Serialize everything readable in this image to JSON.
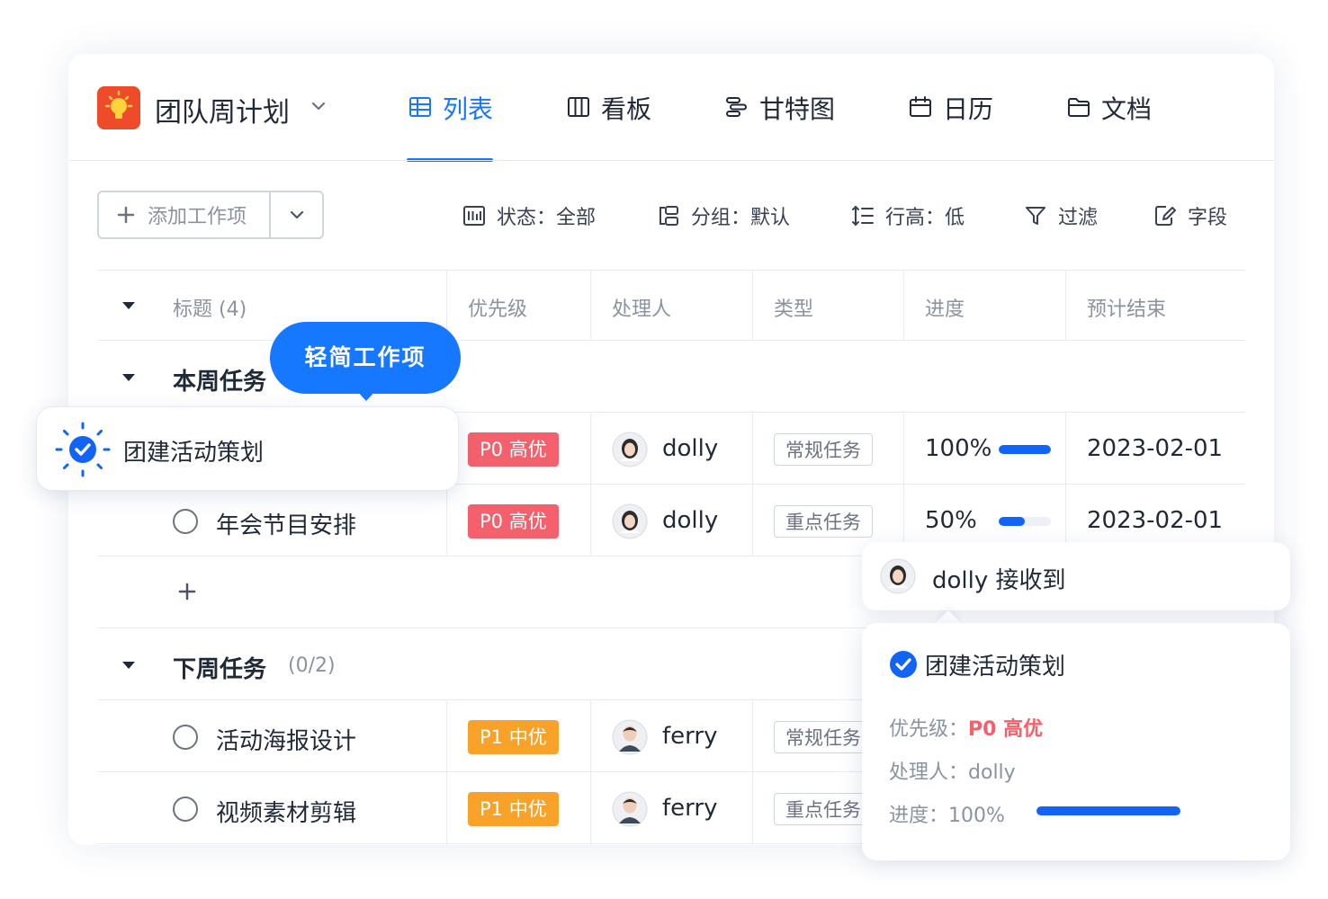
{
  "project": {
    "title": "团队周计划",
    "logo_icon": "lightbulb-icon"
  },
  "tabs": [
    {
      "label": "列表",
      "icon": "table-icon",
      "active": true
    },
    {
      "label": "看板",
      "icon": "kanban-icon",
      "active": false
    },
    {
      "label": "甘特图",
      "icon": "gantt-icon",
      "active": false
    },
    {
      "label": "日历",
      "icon": "calendar-icon",
      "active": false
    },
    {
      "label": "文档",
      "icon": "folder-icon",
      "active": false
    }
  ],
  "toolbar": {
    "add_label": "添加工作项",
    "status": "状态：全部",
    "group": "分组：默认",
    "row_height": "行高：低",
    "filter": "过滤",
    "fields": "字段"
  },
  "table": {
    "headers": {
      "title": "标题",
      "title_count": "(4)",
      "priority": "优先级",
      "assignee": "处理人",
      "type": "类型",
      "progress": "进度",
      "due": "预计结束"
    }
  },
  "groups": [
    {
      "name": "本周任务",
      "tasks": [
        {
          "title": "团建活动策划",
          "priority": "P0 高优",
          "assignee": "dolly",
          "type": "常规任务",
          "progress_text": "100%",
          "progress": 1.0,
          "due": "2023-02-01"
        },
        {
          "title": "年会节目安排",
          "priority": "P0 高优",
          "assignee": "dolly",
          "type": "重点任务",
          "progress_text": "50%",
          "progress": 0.5,
          "due": "2023-02-01"
        }
      ]
    },
    {
      "name": "下周任务",
      "count": "(0/2)",
      "tasks": [
        {
          "title": "活动海报设计",
          "priority": "P1 中优",
          "assignee": "ferry",
          "type": "常规任务"
        },
        {
          "title": "视频素材剪辑",
          "priority": "P1 中优",
          "assignee": "ferry",
          "type": "重点任务"
        }
      ]
    }
  ],
  "callout": {
    "label": "轻简工作项"
  },
  "notification": {
    "text": "dolly 接收到"
  },
  "detail": {
    "title": "团建活动策划",
    "priority_label": "优先级：",
    "priority_value": "P0 高优",
    "assignee_label": "处理人：",
    "assignee_value": "dolly",
    "progress_label": "进度：",
    "progress_value": "100%",
    "progress": 1.0
  },
  "colors": {
    "accent": "#1677ff",
    "p0": "#f4606c",
    "p1": "#f8a22a",
    "progress": "#1264f5"
  }
}
